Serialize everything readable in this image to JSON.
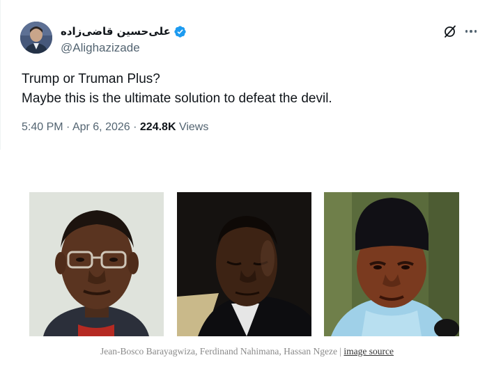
{
  "tweet": {
    "display_name": "علی‌حسین قاضی‌زاده",
    "handle": "@Alighazizade",
    "text_lines": [
      "Trump or Truman Plus?",
      "Maybe this is the ultimate solution to defeat the devil."
    ],
    "time": "5:40 PM",
    "date": "Apr 6, 2026",
    "views_count": "224.8K",
    "views_label": "Views",
    "separator": "·"
  },
  "icons": {
    "verified": "verified-badge-icon",
    "grok": "grok-icon",
    "more": "more-icon"
  },
  "image": {
    "caption_names": "Jean-Bosco Barayagwiza, Ferdinand Nahimana, Hassan Ngeze",
    "caption_separator": "|",
    "source_link": "image source"
  },
  "colors": {
    "verified_blue": "#1d9bf0",
    "text_primary": "#0f1419",
    "text_secondary": "#536471"
  }
}
